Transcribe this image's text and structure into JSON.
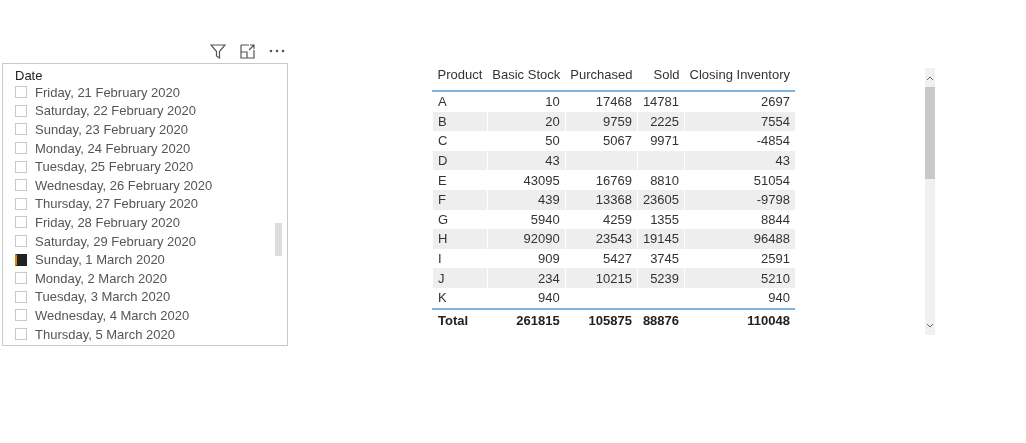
{
  "slicer": {
    "title": "Date",
    "items": [
      {
        "label": "Friday, 21 February 2020",
        "selected": false
      },
      {
        "label": "Saturday, 22 February 2020",
        "selected": false
      },
      {
        "label": "Sunday, 23 February 2020",
        "selected": false
      },
      {
        "label": "Monday, 24 February 2020",
        "selected": false
      },
      {
        "label": "Tuesday, 25 February 2020",
        "selected": false
      },
      {
        "label": "Wednesday, 26 February 2020",
        "selected": false
      },
      {
        "label": "Thursday, 27 February 2020",
        "selected": false
      },
      {
        "label": "Friday, 28 February 2020",
        "selected": false
      },
      {
        "label": "Saturday, 29 February 2020",
        "selected": false
      },
      {
        "label": "Sunday, 1 March 2020",
        "selected": true
      },
      {
        "label": "Monday, 2 March 2020",
        "selected": false
      },
      {
        "label": "Tuesday, 3 March 2020",
        "selected": false
      },
      {
        "label": "Wednesday, 4 March 2020",
        "selected": false
      },
      {
        "label": "Thursday, 5 March 2020",
        "selected": false
      }
    ]
  },
  "table": {
    "columns": [
      "Product",
      "Basic Stock",
      "Purchased",
      "Sold",
      "Closing Inventory"
    ],
    "rows": [
      [
        "A",
        "10",
        "17468",
        "14781",
        "2697"
      ],
      [
        "B",
        "20",
        "9759",
        "2225",
        "7554"
      ],
      [
        "C",
        "50",
        "5067",
        "9971",
        "-4854"
      ],
      [
        "D",
        "43",
        "",
        "",
        "43"
      ],
      [
        "E",
        "43095",
        "16769",
        "8810",
        "51054"
      ],
      [
        "F",
        "439",
        "13368",
        "23605",
        "-9798"
      ],
      [
        "G",
        "5940",
        "4259",
        "1355",
        "8844"
      ],
      [
        "H",
        "92090",
        "23543",
        "19145",
        "96488"
      ],
      [
        "I",
        "909",
        "5427",
        "3745",
        "2591"
      ],
      [
        "J",
        "234",
        "10215",
        "5239",
        "5210"
      ],
      [
        "K",
        "940",
        "",
        "",
        "940"
      ]
    ],
    "total": [
      "Total",
      "261815",
      "105875",
      "88876",
      "110048"
    ]
  }
}
